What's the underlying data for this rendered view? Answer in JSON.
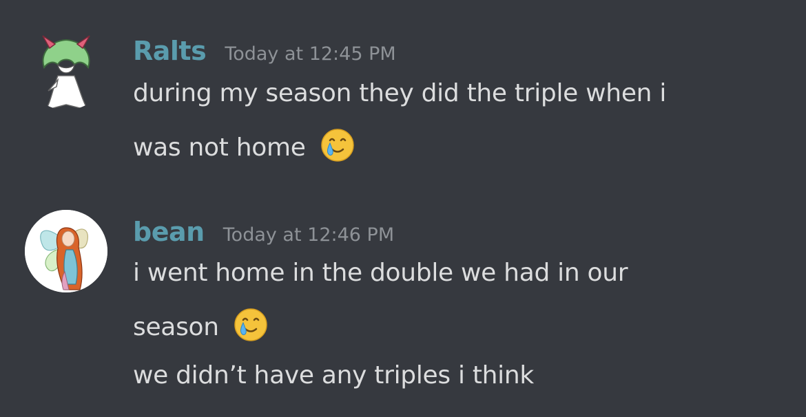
{
  "messages": [
    {
      "username": "Ralts",
      "timestamp": "Today at 12:45 PM",
      "lines": [
        "during my season they did the triple when i",
        "was not home"
      ],
      "emoji": "smiling-face-with-tear-icon"
    },
    {
      "username": "bean",
      "timestamp": "Today at 12:46 PM",
      "lines": [
        "i went home in the double we had in our",
        "season",
        "we didn’t have any triples i think"
      ],
      "emoji": "smiling-face-with-tear-icon"
    }
  ],
  "colors": {
    "background": "#36393f",
    "username": "#5a9cad",
    "timestamp": "#8e9297",
    "text": "#dcddde"
  }
}
